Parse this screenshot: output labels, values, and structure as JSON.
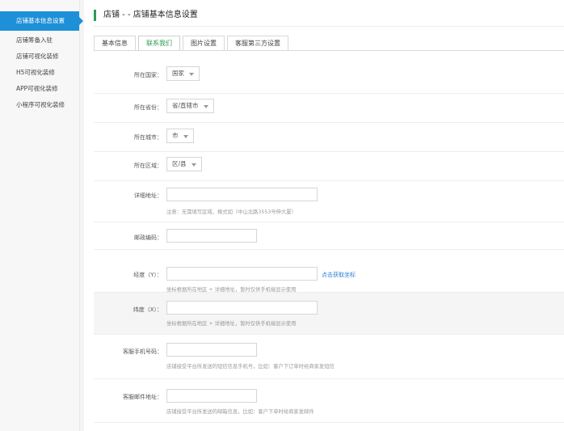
{
  "sidebar": {
    "items": [
      {
        "label": "店铺基本信息设置",
        "active": true
      },
      {
        "label": "店铺筹备入驻",
        "active": false
      },
      {
        "label": "店铺可视化装修",
        "active": false
      },
      {
        "label": "H5可视化装修",
        "active": false
      },
      {
        "label": "APP可视化装修",
        "active": false
      },
      {
        "label": "小程序可视化装修",
        "active": false
      }
    ]
  },
  "header": {
    "title": "店铺 - - 店铺基本信息设置"
  },
  "tabs": [
    {
      "label": "基本信息",
      "active": false
    },
    {
      "label": "联系我们",
      "active": true
    },
    {
      "label": "图片设置",
      "active": false
    },
    {
      "label": "客服第三方设置",
      "active": false
    }
  ],
  "form": {
    "country": {
      "label": "所在国家：",
      "value": "国家"
    },
    "province": {
      "label": "所在省份：",
      "value": "省/直辖市"
    },
    "city": {
      "label": "所在城市：",
      "value": "市"
    },
    "district": {
      "label": "所在区域：",
      "value": "区/县"
    },
    "address": {
      "label": "详细地址：",
      "value": "",
      "hint": "注意：无需填写区域，格式如（中山北路3553号伸大厦）"
    },
    "postcode": {
      "label": "邮政编码：",
      "value": ""
    },
    "latitude": {
      "label": "经度（Y）：",
      "value": "",
      "link": "点击获取坐标",
      "hint": "坐标根据所在地区 + 详细地址，暂时仅供手机端显示使用"
    },
    "longitude": {
      "label": "纬度（X）：",
      "value": "",
      "hint": "坐标根据所在地区 + 详细地址，暂时仅供手机端显示使用"
    },
    "phone": {
      "label": "客服手机号码：",
      "value": "",
      "hint": "店铺接受平台所发送的短信信息手机号，比如：客户下订单时给商家发短信"
    },
    "email": {
      "label": "客服邮件地址：",
      "value": "",
      "hint": "店铺接受平台所发送的邮箱信息，比如：客户下单时给商家发邮件"
    }
  }
}
